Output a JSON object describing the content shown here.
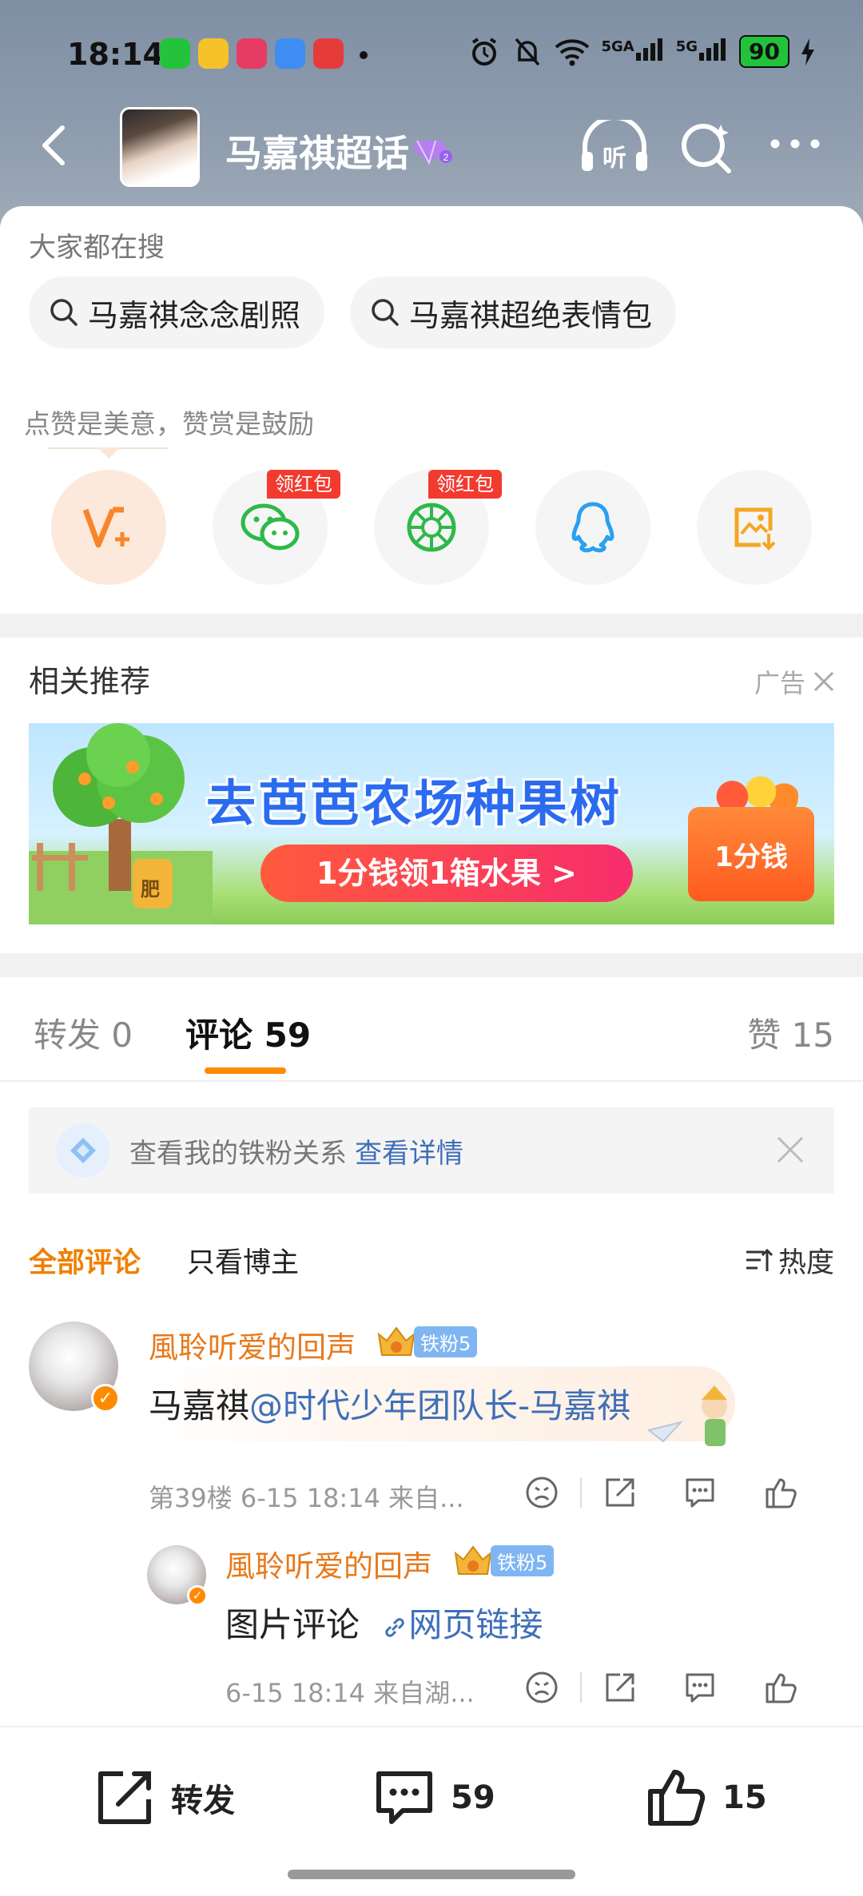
{
  "status_bar": {
    "time": "18:14",
    "battery": "90",
    "net1": "5GA",
    "net2": "5G"
  },
  "header": {
    "title": "马嘉祺超话"
  },
  "hot_search": {
    "label": "大家都在搜",
    "chips": [
      "马嘉祺念念剧照",
      "马嘉祺超绝表情包"
    ]
  },
  "share": {
    "praise_hint": "点赞是美意，赞赏是鼓励",
    "red_tag": "领红包",
    "icons": [
      "vplus-icon",
      "wechat-icon",
      "moments-icon",
      "qq-icon",
      "save-image-icon"
    ]
  },
  "recommend": {
    "title": "相关推荐",
    "ad_label": "广告",
    "banner_title": "去芭芭农场种果树",
    "banner_button": "1分钱领1箱水果 >",
    "banner_box": "1分钱",
    "banner_pot": "肥"
  },
  "tabs": {
    "repost": "转发 0",
    "comments": "评论 59",
    "likes": "赞 15"
  },
  "fan_relation": {
    "text": "查看我的铁粉关系",
    "link": "查看详情"
  },
  "filters": {
    "all": "全部评论",
    "author": "只看博主",
    "sort": "热度"
  },
  "comments": [
    {
      "user": "風聆听爱的回声",
      "fan_level": "铁粉5",
      "text_prefix": "马嘉祺",
      "mention": "@时代少年团队长-马嘉祺",
      "meta": "第39楼  6-15 18:14  来自..."
    },
    {
      "user": "風聆听爱的回声",
      "fan_level": "铁粉5",
      "text_prefix": "图片评论",
      "link": "网页链接",
      "meta": "6-15 18:14  来自湖..."
    }
  ],
  "bottom_bar": {
    "repost": "转发",
    "comment_count": "59",
    "like_count": "15"
  },
  "colors": {
    "accent": "#ff8a00",
    "username": "#e8791b",
    "link": "#3f6fb8",
    "red_tag": "#f23a2f"
  }
}
